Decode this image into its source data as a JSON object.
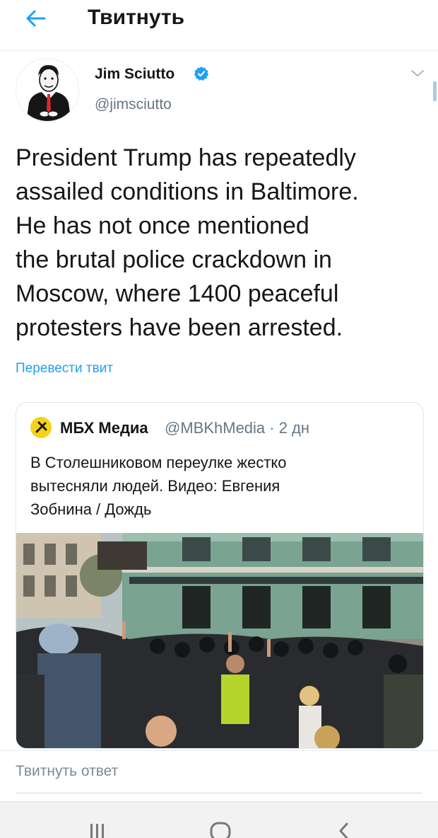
{
  "header": {
    "title": "Твитнуть",
    "back_icon": "arrow-left-icon",
    "accent": "#1da1f2"
  },
  "tweet": {
    "author_name": "Jim Sciutto",
    "author_handle": "@jimsciutto",
    "verified": true,
    "text_lines": [
      "President Trump has repeatedly",
      "assailed conditions in Baltimore.",
      "He has not once mentioned",
      "the brutal police crackdown in",
      "Moscow, where 1400 peaceful",
      "protesters have been arrested."
    ],
    "translate_label": "Перевести твит"
  },
  "quote": {
    "author_name": "МБХ Медиа",
    "author_handle": "@MBKhMedia",
    "time": "2 дн",
    "meta": "@MBKhMedia · 2 дн",
    "text_lines": [
      "В Столешниковом переулке жестко",
      "вытесняли людей. Видео: Евгения",
      "Зобнина / Дождь"
    ],
    "media": "video-thumbnail-protest-police"
  },
  "reply": {
    "placeholder": "Твитнуть ответ"
  },
  "navbar": {
    "icons": [
      "recent-apps-icon",
      "home-icon",
      "back-icon"
    ]
  }
}
